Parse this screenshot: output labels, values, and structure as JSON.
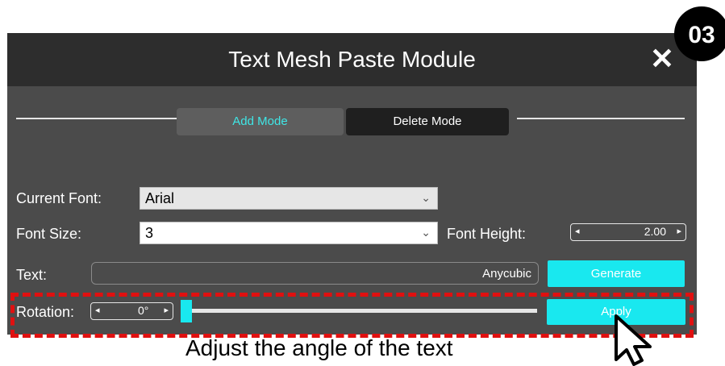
{
  "step": "03",
  "window": {
    "title": "Text Mesh Paste Module",
    "close_symbol": "✕"
  },
  "modes": {
    "add": "Add Mode",
    "delete": "Delete Mode"
  },
  "current_font": {
    "label": "Current Font:",
    "value": "Arial"
  },
  "font_size": {
    "label": "Font Size:",
    "value": "3"
  },
  "font_height": {
    "label": "Font Height:",
    "value": "2.00"
  },
  "text": {
    "label": "Text:",
    "value": "Anycubic"
  },
  "rotation": {
    "label": "Rotation:",
    "value": "0°"
  },
  "buttons": {
    "generate": "Generate",
    "apply": "Apply"
  },
  "caption": "Adjust the angle of the text"
}
